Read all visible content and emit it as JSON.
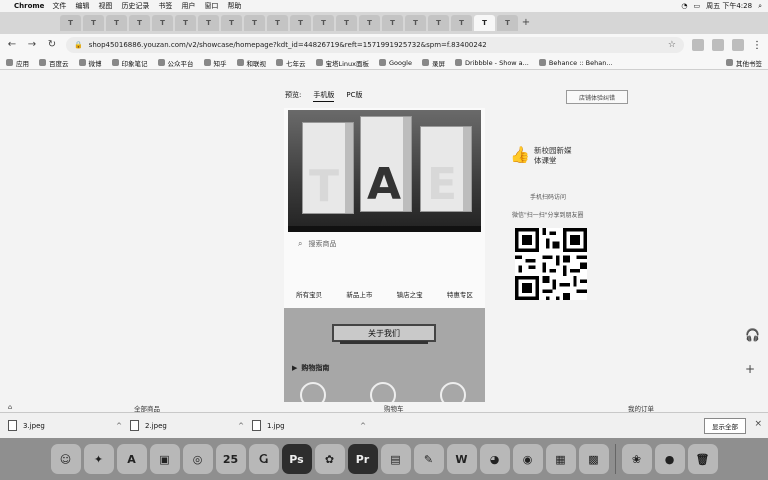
{
  "menubar": {
    "app_name": "Chrome",
    "items": [
      "文件",
      "编辑",
      "视图",
      "历史记录",
      "书签",
      "用户",
      "窗口",
      "帮助"
    ],
    "clock": "周五 下午4:28"
  },
  "tabs": [
    "T",
    "T",
    "T",
    "T",
    "T",
    "T",
    "T",
    "T",
    "T",
    "T",
    "T",
    "T",
    "T",
    "T",
    "T",
    "T",
    "T",
    "T",
    "T",
    "T"
  ],
  "toolbar": {
    "url": "shop45016886.youzan.com/v2/showcase/homepage?kdt_id=44826719&reft=1571991925732&spm=f.83400242"
  },
  "bookmarks": {
    "items": [
      "应用",
      "百度云",
      "微博",
      "印象笔记",
      "公众平台",
      "知乎",
      "和联视",
      "七年云",
      "宝塔Linux面板",
      "Google",
      "录屏",
      "Dribbble - Show a...",
      "Behance :: Behan..."
    ],
    "other": "其他书签"
  },
  "preview": {
    "label": "预览:",
    "tab_mobile": "手机版",
    "tab_pc": "PC版",
    "feedback": "店铺体验纠错"
  },
  "banner_letters": [
    "T",
    "A",
    "E"
  ],
  "search": {
    "placeholder": "搜索商品"
  },
  "shop_nav": [
    "所有宝贝",
    "新品上市",
    "镇店之宝",
    "特惠专区"
  ],
  "about": {
    "button": "关于我们",
    "guide": "购物指南"
  },
  "side": {
    "shop_name_line1": "新校园新媒",
    "shop_name_line2": "体课堂",
    "mobile_label": "手机扫码访问",
    "share_label": "微信\"扫一扫\"分享到朋友圈"
  },
  "bottom_nav": [
    "全部商品",
    "购物车",
    "我的订单"
  ],
  "downloads": {
    "files": [
      "3.jpeg",
      "2.jpeg",
      "1.jpg"
    ],
    "show_all": "显示全部"
  },
  "dock": {
    "apps": [
      "finder",
      "launchpad",
      "app-store",
      "preview",
      "safari",
      "calendar",
      "adobe",
      "photoshop",
      "bridge",
      "premiere",
      "keynote",
      "pages",
      "wps",
      "qq",
      "wechat",
      "notes",
      "screenshot",
      "tools",
      "browser",
      "trash"
    ],
    "calendar_day": "25",
    "ps_label": "Ps",
    "pr_label": "Pr"
  },
  "colors": {
    "page_bg": "#f3f3f3",
    "about_bg": "#a7a7a7"
  }
}
